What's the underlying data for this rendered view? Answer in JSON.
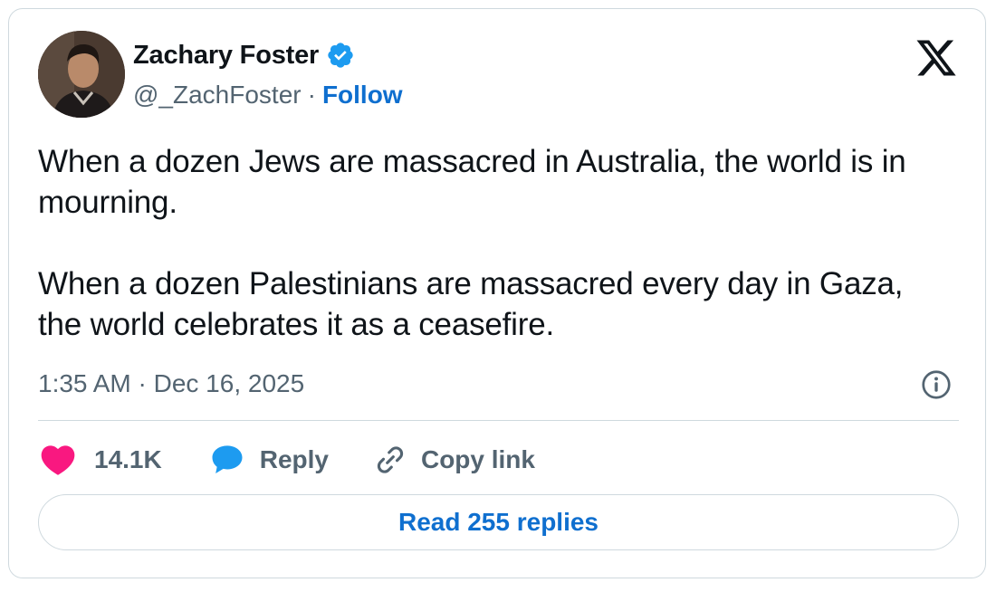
{
  "author": {
    "display_name": "Zachary Foster",
    "handle": "@_ZachFoster",
    "separator": "·",
    "follow_label": "Follow",
    "verified_icon": "verified-badge-icon",
    "avatar_icon": "avatar"
  },
  "platform": {
    "logo_icon": "x-logo-icon"
  },
  "tweet": {
    "paragraph_1": "When a dozen Jews are massacred in Australia, the world is in mourning.",
    "paragraph_2": "When a dozen Palestinians are massacred every day in Gaza, the world celebrates it as a ceasefire.",
    "timestamp": "1:35 AM · Dec 16, 2025",
    "info_icon": "info-icon"
  },
  "actions": {
    "like_count": "14.1K",
    "like_icon": "heart-icon",
    "reply_label": "Reply",
    "reply_icon": "speech-bubble-icon",
    "copy_label": "Copy link",
    "copy_icon": "link-icon"
  },
  "read_replies": {
    "label": "Read 255 replies"
  },
  "colors": {
    "text": "#0f1419",
    "secondary": "#536471",
    "link": "#0f6fcf",
    "like": "#f91880",
    "reply": "#1d9bf0",
    "border": "#cfd9de"
  }
}
